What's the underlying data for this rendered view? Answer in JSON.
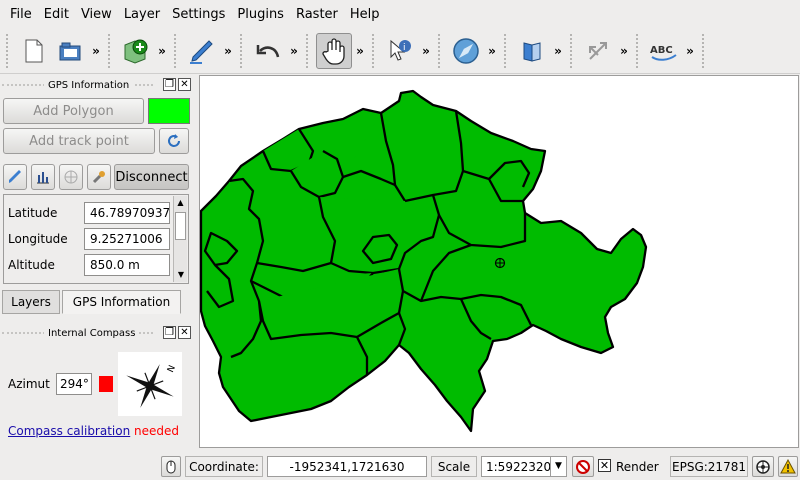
{
  "menu": [
    "File",
    "Edit",
    "View",
    "Layer",
    "Settings",
    "Plugins",
    "Raster",
    "Help"
  ],
  "toolbar": {
    "buttons": [
      "new-document",
      "open-folder",
      "add-layer",
      "edit-pencil",
      "undo",
      "pan-hand",
      "identify",
      "compass",
      "book",
      "arrows",
      "spell-check"
    ],
    "more": "»"
  },
  "gps": {
    "title": "GPS Information",
    "add_polygon": "Add Polygon",
    "add_track_point": "Add track point",
    "connect_label": "Disconnect",
    "polygon_color": "#00ff00",
    "fields": [
      {
        "label": "Latitude",
        "value": "46.78970937"
      },
      {
        "label": "Longitude",
        "value": "9.25271006"
      },
      {
        "label": "Altitude",
        "value": "850.0 m"
      }
    ]
  },
  "tabs": {
    "layers": "Layers",
    "gps": "GPS Information"
  },
  "compass": {
    "title": "Internal Compass",
    "azimut_label": "Azimut",
    "azimut_value": "294°",
    "calibration_link": "Compass calibration",
    "calibration_status": "needed",
    "status_color": "#ff0000"
  },
  "map": {
    "fill": "#00bb00",
    "stroke": "#000000"
  },
  "statusbar": {
    "coordinate_label": "Coordinate:",
    "coordinate_value": "-1952341,1721630",
    "scale_label": "Scale",
    "scale_value": "1:5922320",
    "render_label": "Render",
    "epsg": "EPSG:21781"
  }
}
